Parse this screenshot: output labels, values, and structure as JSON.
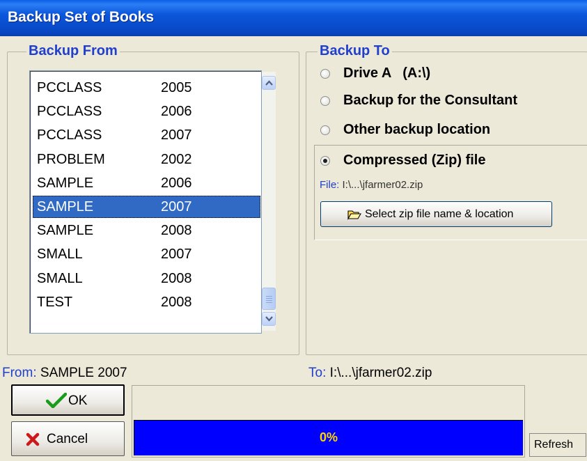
{
  "window": {
    "title": "Backup Set of Books"
  },
  "backup_from": {
    "title": "Backup From",
    "books": [
      {
        "name": "PCCLASS",
        "year": "2005"
      },
      {
        "name": "PCCLASS",
        "year": "2006"
      },
      {
        "name": "PCCLASS",
        "year": "2007"
      },
      {
        "name": "PROBLEM",
        "year": "2002"
      },
      {
        "name": "SAMPLE",
        "year": "2006"
      },
      {
        "name": "SAMPLE",
        "year": "2007"
      },
      {
        "name": "SAMPLE",
        "year": "2008"
      },
      {
        "name": "SMALL",
        "year": "2007"
      },
      {
        "name": "SMALL",
        "year": "2008"
      },
      {
        "name": "TEST",
        "year": "2008"
      }
    ],
    "selected_index": 5
  },
  "backup_to": {
    "title": "Backup To",
    "options": [
      {
        "label": "Drive A   (A:\\)",
        "selected": false
      },
      {
        "label": "Backup for the Consultant",
        "selected": false
      },
      {
        "label": "Other backup location",
        "selected": false
      },
      {
        "label": "Compressed (Zip) file",
        "selected": true
      }
    ],
    "file_key": "File:",
    "file_value": "I:\\...\\jfarmer02.zip",
    "select_zip_button": "Select zip file name & location"
  },
  "status": {
    "from_key": "From:",
    "from_value": "SAMPLE 2007",
    "to_key": "To:",
    "to_value": "I:\\...\\jfarmer02.zip"
  },
  "buttons": {
    "ok": "OK",
    "cancel": "Cancel",
    "refresh": "Refresh"
  },
  "progress": {
    "text": "0%",
    "value": 0
  },
  "colors": {
    "title_bar": "#0b56db",
    "group_title": "#1f3fcc",
    "selection": "#316ac5",
    "progress_fill": "#0000ff",
    "progress_text": "#ffd700"
  },
  "icons": {
    "ok": "check-icon",
    "cancel": "x-icon",
    "select_zip": "folder-open-icon"
  }
}
